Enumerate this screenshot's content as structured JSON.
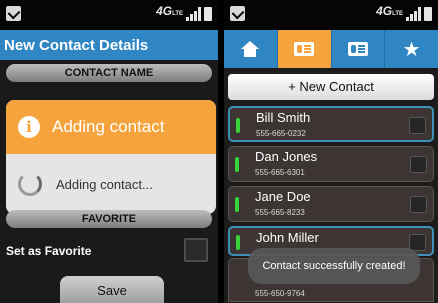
{
  "status_bar": {
    "network": "4G",
    "network_sub": "LTE"
  },
  "left": {
    "header_title": "New Contact Details",
    "section_contact_name": "CONTACT NAME",
    "dialog": {
      "title": "Adding contact",
      "message": "Adding contact..."
    },
    "section_favorite": "FAVORITE",
    "favorite_label": "Set as Favorite",
    "save_label": "Save"
  },
  "right": {
    "tabs": [
      {
        "icon": "home-icon",
        "active": false
      },
      {
        "icon": "contact-card-icon",
        "active": true
      },
      {
        "icon": "contact-card-icon",
        "active": false
      },
      {
        "icon": "star-icon",
        "active": false
      }
    ],
    "new_contact_label": "+ New Contact",
    "contacts": [
      {
        "name": "Bill Smith",
        "phone": "555-665-0232"
      },
      {
        "name": "Dan Jones",
        "phone": "555-665-6301"
      },
      {
        "name": "Jane Doe",
        "phone": "555-665-8233"
      },
      {
        "name": "John Miller",
        "phone": "555-650-9764"
      }
    ],
    "toast": "Contact successfully created!"
  },
  "colors": {
    "header_blue": "#2f86c2",
    "accent_orange": "#f5a43d",
    "favorite_green": "#37d33a"
  }
}
